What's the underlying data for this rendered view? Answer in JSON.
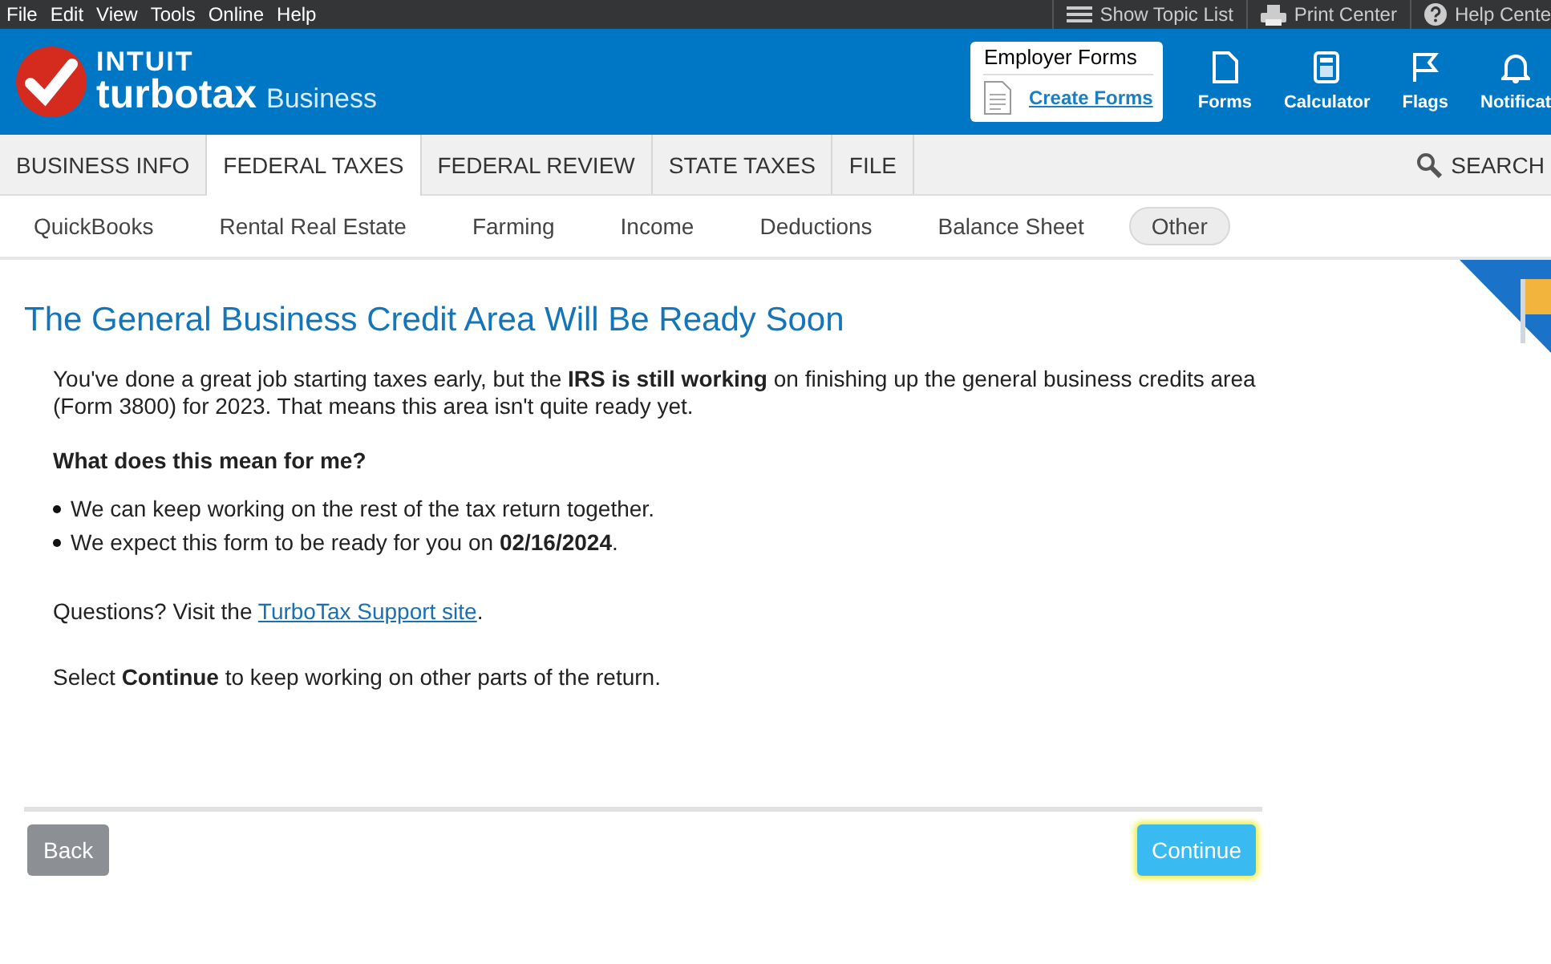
{
  "menu_bar": {
    "menus": [
      "File",
      "Edit",
      "View",
      "Tools",
      "Online",
      "Help"
    ],
    "tools": [
      {
        "kind": "topics",
        "label": "Show Topic List"
      },
      {
        "kind": "print",
        "label": "Print Center"
      },
      {
        "kind": "help",
        "label": "Help Cente"
      }
    ]
  },
  "header": {
    "brand": "INTUIT",
    "product": "turbotax",
    "edition": "Business",
    "employer_forms": {
      "title": "Employer Forms",
      "link": "Create Forms"
    },
    "tools": [
      {
        "kind": "forms",
        "label": "Forms"
      },
      {
        "kind": "calculator",
        "label": "Calculator"
      },
      {
        "kind": "flags",
        "label": "Flags"
      },
      {
        "kind": "notifications",
        "label": "Notificat"
      }
    ]
  },
  "tabs": [
    {
      "label": "BUSINESS INFO",
      "selected": false
    },
    {
      "label": "FEDERAL TAXES",
      "selected": true
    },
    {
      "label": "FEDERAL REVIEW",
      "selected": false
    },
    {
      "label": "STATE TAXES",
      "selected": false
    },
    {
      "label": "FILE",
      "selected": false
    }
  ],
  "search": "SEARCH",
  "subtabs": [
    {
      "label": "QuickBooks",
      "selected": false
    },
    {
      "label": "Rental Real Estate",
      "selected": false
    },
    {
      "label": "Farming",
      "selected": false
    },
    {
      "label": "Income",
      "selected": false
    },
    {
      "label": "Deductions",
      "selected": false
    },
    {
      "label": "Balance Sheet",
      "selected": false
    },
    {
      "label": "Other",
      "selected": true
    }
  ],
  "page": {
    "title": "The General Business Credit Area Will Be Ready Soon",
    "intro": "You've done a great job starting taxes early, but the **IRS is still working** on finishing up the general business credits area (Form 3800) for 2023. That means this area isn't quite ready yet.",
    "question": "What does this mean for me?",
    "bullets": [
      "We can keep working on the rest of the tax return together.",
      "We expect this form to be ready for you on **02/16/2024**."
    ],
    "questions_text": "Questions? Visit the",
    "support_link": "TurboTax Support site",
    "questions_end": ".",
    "continue_note": "Select **Continue** to keep working on other parts of the return."
  },
  "buttons": {
    "back": "Back",
    "continue": "Continue"
  }
}
